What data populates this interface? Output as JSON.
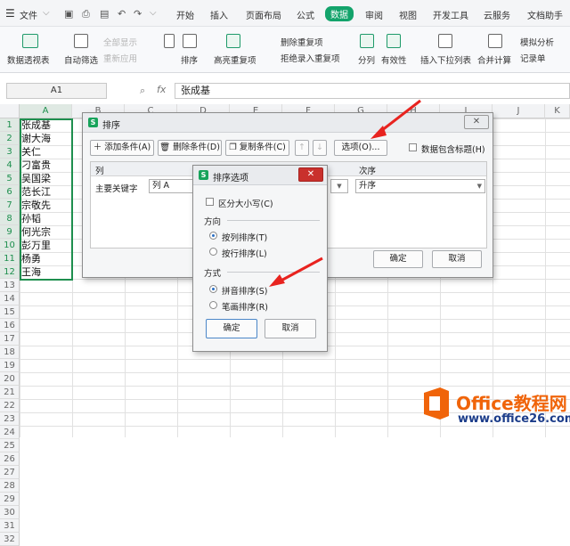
{
  "menu": {
    "file": "文件",
    "tabs": [
      "开始",
      "插入",
      "页面布局",
      "公式",
      "数据",
      "审阅",
      "视图",
      "开发工具",
      "云服务",
      "文档助手"
    ],
    "active_tab": "数据"
  },
  "ribbon": {
    "pivot": "数据透视表",
    "autofilter": "自动筛选",
    "show_all": "全部显示",
    "reapply": "重新应用",
    "sort": "排序",
    "highlight_dup": "高亮重复项",
    "delete_dup": "删除重复项",
    "reject_dup": "拒绝录入重复项",
    "split": "分列",
    "validity": "有效性",
    "dropdown": "插入下拉列表",
    "consolidate": "合并计算",
    "simulate": "模拟分析",
    "record": "记录单"
  },
  "formula_bar": {
    "name_box": "A1",
    "fx": "fx",
    "value": "张成基"
  },
  "sheet": {
    "columns": [
      "A",
      "B",
      "C",
      "D",
      "E",
      "F",
      "G",
      "H",
      "I",
      "J",
      "K"
    ],
    "rows": [
      "1",
      "2",
      "3",
      "4",
      "5",
      "6",
      "7",
      "8",
      "9",
      "10",
      "11",
      "12",
      "13",
      "14",
      "15",
      "16",
      "17",
      "18",
      "19",
      "20",
      "21",
      "22",
      "23",
      "24",
      "25",
      "26",
      "27",
      "28",
      "29",
      "30",
      "31",
      "32"
    ],
    "col_a": [
      "张成基",
      "谢大海",
      "关仁",
      "刁富贵",
      "吴国梁",
      "范长江",
      "宗敬先",
      "孙韬",
      "何光宗",
      "彭万里",
      "杨勇",
      "王海"
    ]
  },
  "sort_dialog": {
    "title": "排序",
    "add_condition": "添加条件(A)",
    "delete_condition": "删除条件(D)",
    "copy_condition": "复制条件(C)",
    "options": "选项(O)...",
    "header_checkbox": "数据包含标题(H)",
    "col_header": "列",
    "order_header": "次序",
    "primary_key": "主要关键字",
    "column_value": "列 A",
    "order_value": "升序",
    "ok": "确定",
    "cancel": "取消"
  },
  "options_dialog": {
    "title": "排序选项",
    "case_sensitive": "区分大小写(C)",
    "direction_label": "方向",
    "by_column": "按列排序(T)",
    "by_row": "按行排序(L)",
    "method_label": "方式",
    "pinyin": "拼音排序(S)",
    "stroke": "笔画排序(R)",
    "ok": "确定",
    "cancel": "取消",
    "close": "✕"
  },
  "watermark": {
    "brand": "Office教程网",
    "url": "www.office26.com"
  },
  "colors": {
    "accent": "#13a36b",
    "selection": "#1e8f4e",
    "arrow": "#e8231f",
    "watermark_orange": "#f0640a"
  }
}
